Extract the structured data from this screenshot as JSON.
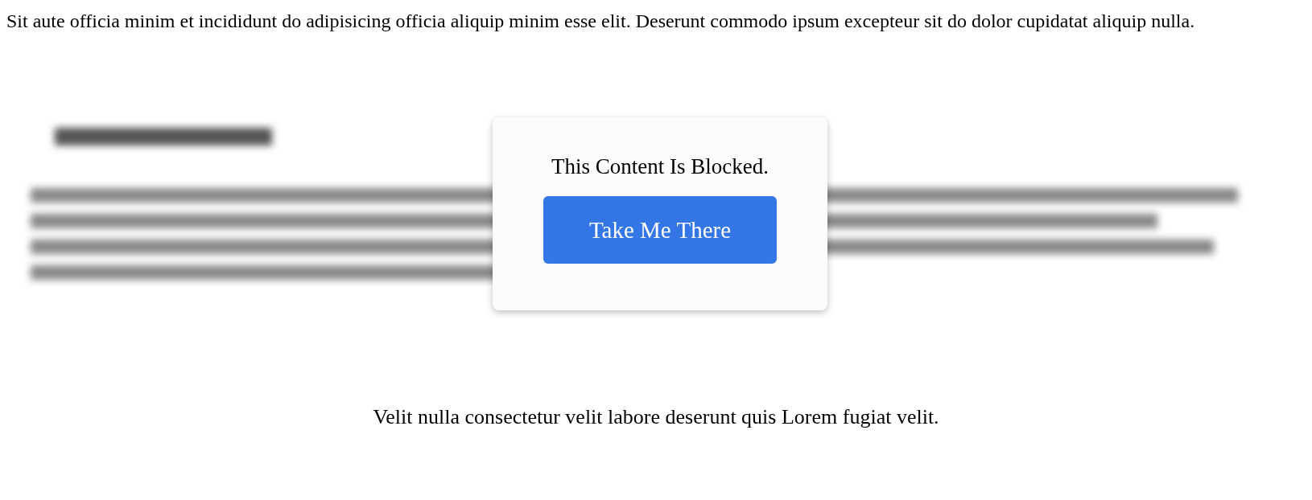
{
  "intro": "Sit aute officia minim et incididunt do adipisicing officia aliquip minim esse elit. Deserunt commodo ipsum excepteur sit do dolor cupidatat aliquip nulla.",
  "blocker": {
    "message": "This Content Is Blocked.",
    "button": "Take Me There"
  },
  "footer": "Velit nulla consectetur velit labore deserunt quis Lorem fugiat velit."
}
